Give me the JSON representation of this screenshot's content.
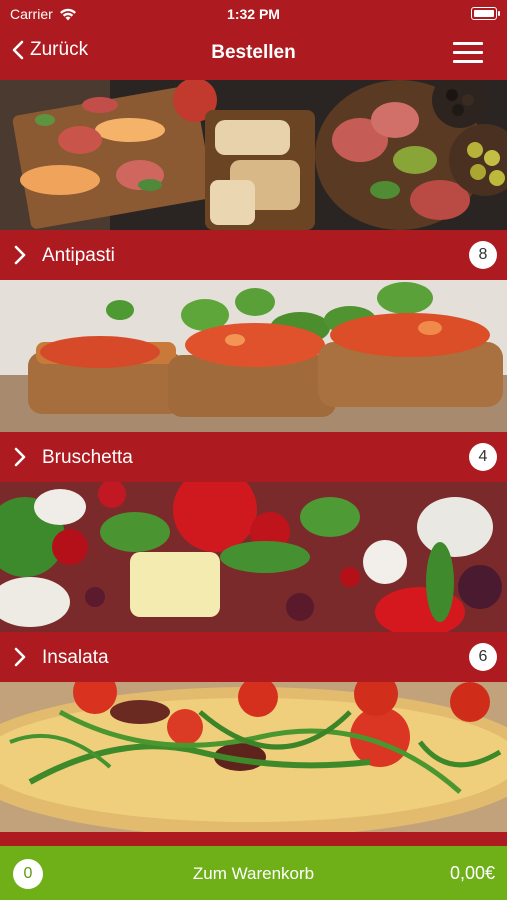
{
  "status": {
    "carrier": "Carrier",
    "time": "1:32 PM"
  },
  "nav": {
    "back_label": "Zurück",
    "title": "Bestellen"
  },
  "categories": [
    {
      "label": "Antipasti",
      "count": "8"
    },
    {
      "label": "Bruschetta",
      "count": "4"
    },
    {
      "label": "Insalata",
      "count": "6"
    }
  ],
  "footer": {
    "cart_count": "0",
    "cart_label": "Zum Warenkorb",
    "total": "0,00€"
  },
  "colors": {
    "header_red": "#ad1a1f",
    "footer_green": "#6fb019"
  },
  "icons": [
    "wifi-icon",
    "battery-icon",
    "chevron-left-icon",
    "hamburger-menu-icon",
    "chevron-right-icon"
  ]
}
